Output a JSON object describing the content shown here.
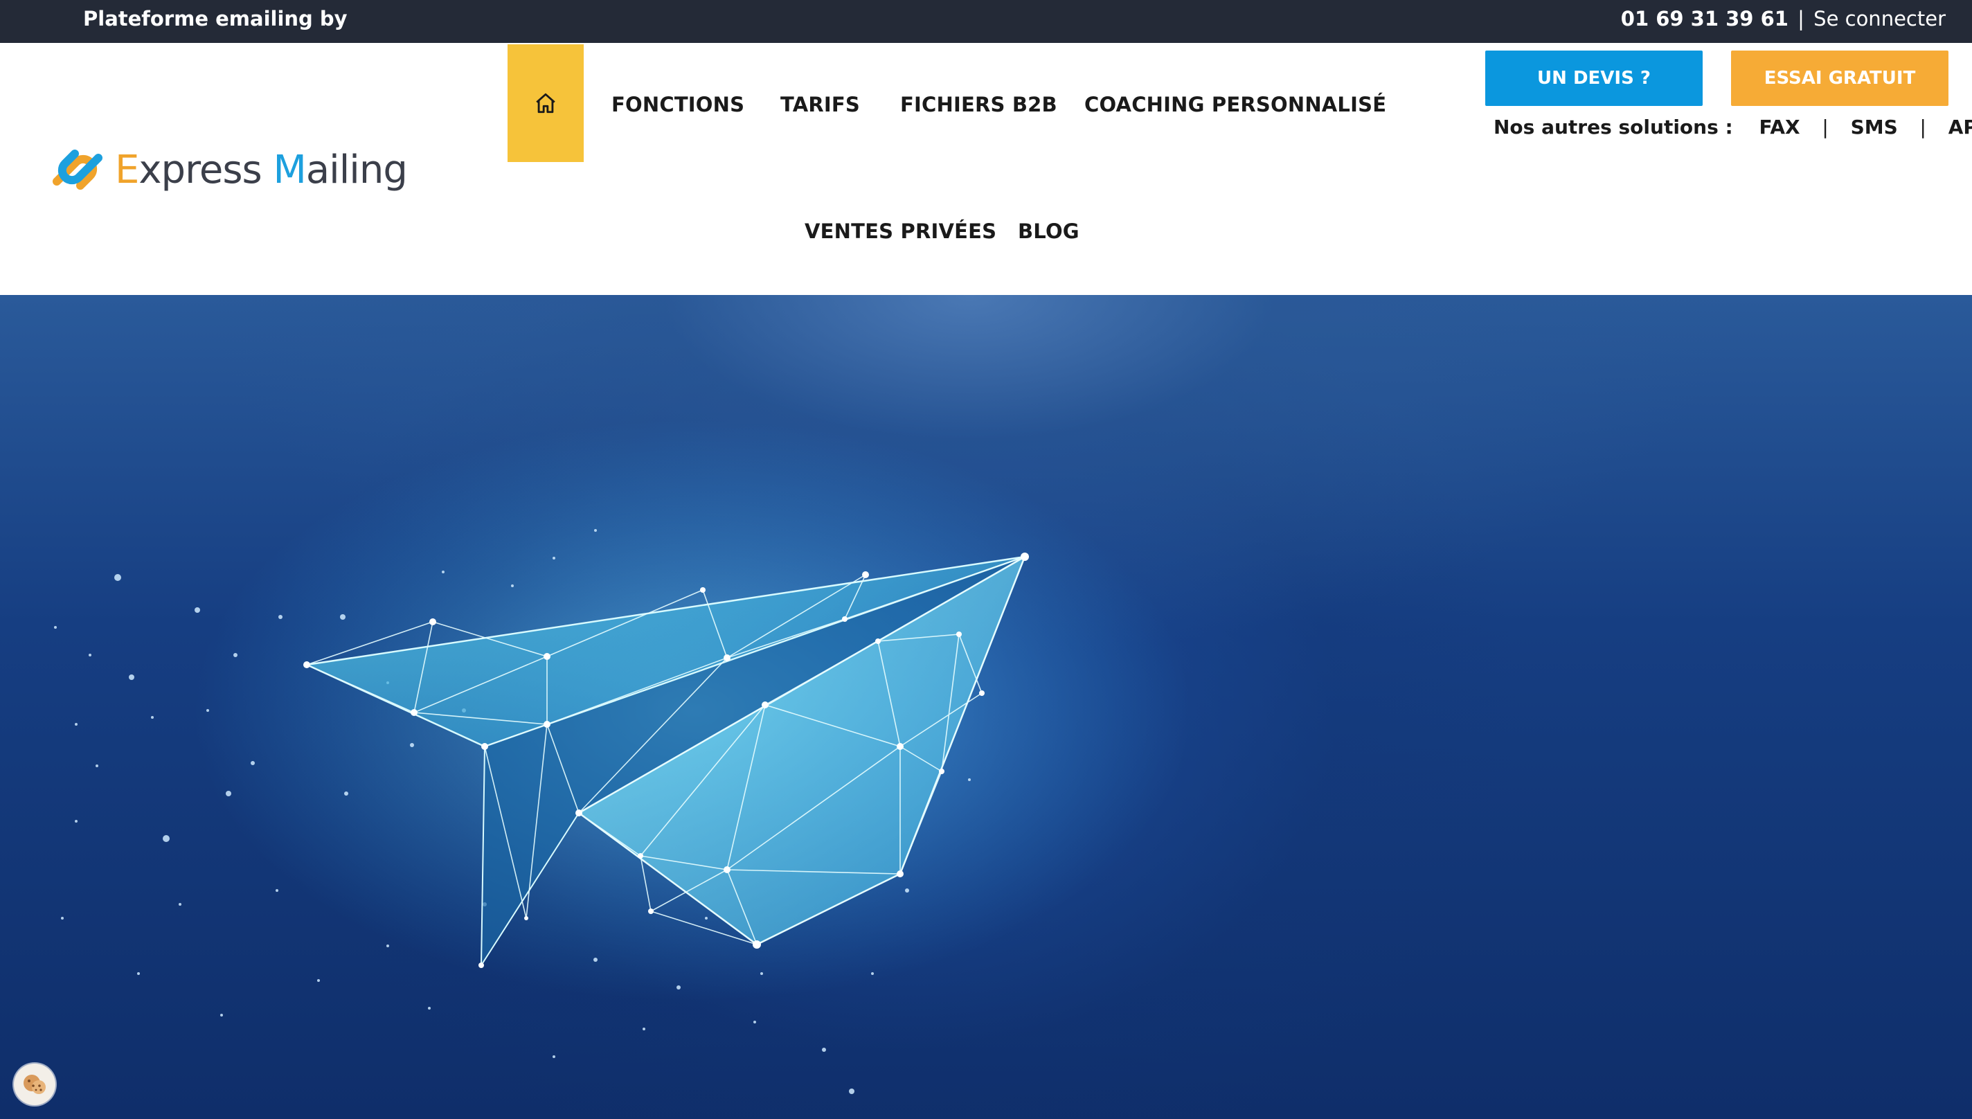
{
  "topbar": {
    "tagline": "Plateforme emailing by",
    "phone": "01 69 31 39 61",
    "separator": "|",
    "login": "Se connecter"
  },
  "logo": {
    "first_letter": "E",
    "first_rest": "xpress",
    "second_letter": "M",
    "second_rest": "ailing"
  },
  "nav": {
    "home_icon": "home-icon",
    "items": [
      {
        "label": "FONCTIONS"
      },
      {
        "label": "TARIFS"
      },
      {
        "label": "FICHIERS B2B"
      },
      {
        "label": "COACHING PERSONNALISÉ"
      },
      {
        "label": "VENTES PRIVÉES"
      },
      {
        "label": "BLOG"
      }
    ]
  },
  "cta": {
    "devis": "UN DEVIS ?",
    "essai": "ESSAI GRATUIT"
  },
  "other_solutions": {
    "label": "Nos autres solutions :",
    "links": [
      "FAX",
      "SMS",
      "API SMTP"
    ],
    "pipe": "|"
  },
  "hero": {
    "image": "paper-plane-illustration"
  },
  "cookie": {
    "icon": "cookie-icon"
  },
  "colors": {
    "topbar": "#242a37",
    "home_tab": "#f6c33a",
    "devis_button": "#0b97de",
    "essai_button": "#f6ab36",
    "logo_orange": "#f0a32b",
    "logo_blue": "#1da0de",
    "hero_blue": "#163e82"
  }
}
